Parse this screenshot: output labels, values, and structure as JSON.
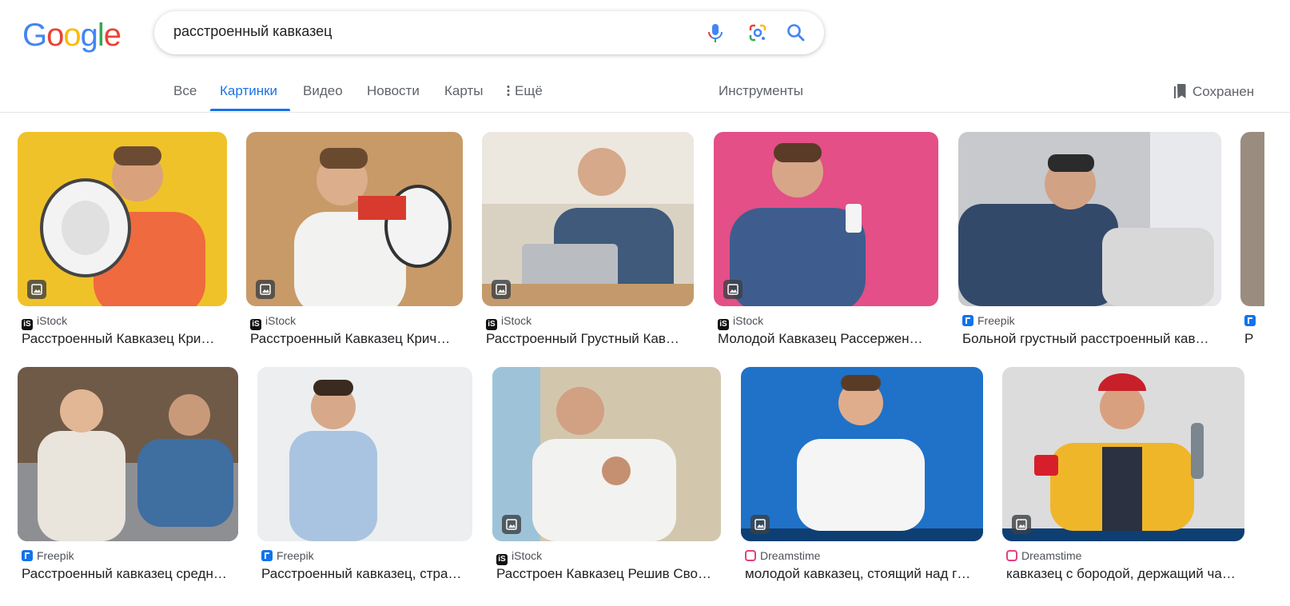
{
  "logo": {
    "letters": [
      "G",
      "o",
      "o",
      "g",
      "l",
      "e"
    ],
    "colors": [
      "#4285f4",
      "#ea4335",
      "#fbbc05",
      "#4285f4",
      "#34a853",
      "#ea4335"
    ]
  },
  "search": {
    "query": "расстроенный кавказец",
    "icons": [
      "microphone-icon",
      "lens-icon",
      "search-icon"
    ]
  },
  "tabs": {
    "all": "Все",
    "images": "Картинки",
    "video": "Видео",
    "news": "Новости",
    "maps": "Карты",
    "more": "Ещё",
    "tools": "Инструменты",
    "saved": "Сохранен"
  },
  "results": [
    {
      "source": "iStock",
      "source_icon": "istock",
      "title": "Расстроенный Кавказец Кри…",
      "bg": "#f0c22a"
    },
    {
      "source": "iStock",
      "source_icon": "istock",
      "title": "Расстроенный Кавказец Крич…",
      "bg": "#c89a68"
    },
    {
      "source": "iStock",
      "source_icon": "istock",
      "title": "Расстроенный Грустный Кав…",
      "bg": "#cfc4b2"
    },
    {
      "source": "iStock",
      "source_icon": "istock",
      "title": "Молодой Кавказец Рассержен…",
      "bg": "#e34f86"
    },
    {
      "source": "Freepik",
      "source_icon": "freepik",
      "title": "Больной грустный расстроенный кав…",
      "bg": "#b9bcc1"
    },
    {
      "source": "Freepik",
      "source_icon": "freepik",
      "title": "Расстроенный кавказец средн…",
      "bg": "#8c7058"
    },
    {
      "source": "Freepik",
      "source_icon": "freepik",
      "title": "Расстроенный кавказец, стра…",
      "bg": "#eceef0"
    },
    {
      "source": "iStock",
      "source_icon": "istock",
      "title": "Расстроен Кавказец Решив Сво…",
      "bg": "#c9c3b2"
    },
    {
      "source": "Dreamstime",
      "source_icon": "dreamstime",
      "title": "молодой кавказец, стоящий над г…",
      "bg": "#1f72c8"
    },
    {
      "source": "Dreamstime",
      "source_icon": "dreamstime",
      "title": "кавказец с бородой, держащий ча…",
      "bg": "#dcdcdc"
    }
  ],
  "partial_result": {
    "source": "F",
    "title": "Р"
  }
}
